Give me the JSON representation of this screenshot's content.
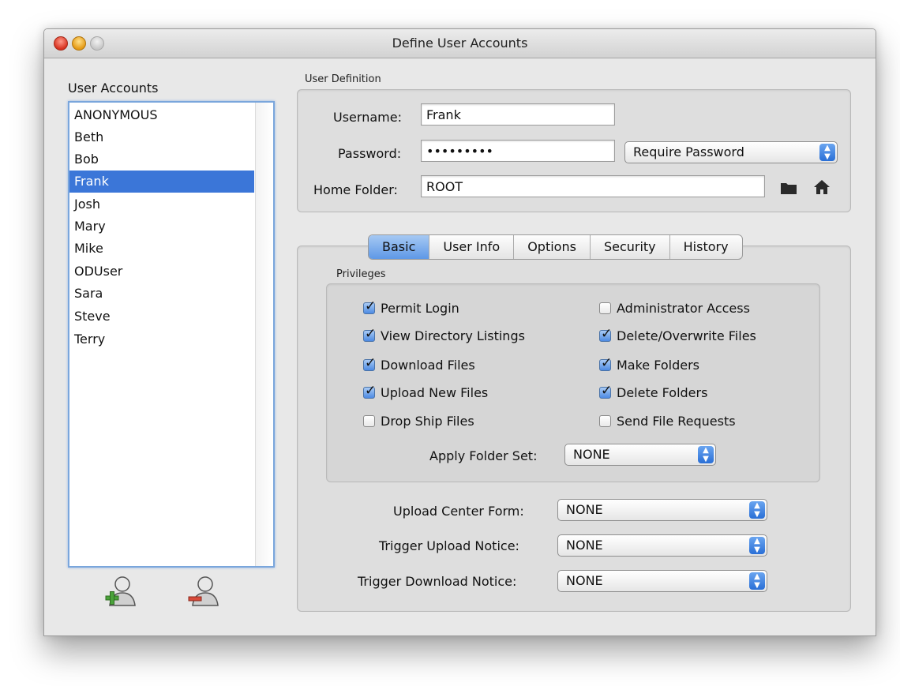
{
  "window": {
    "title": "Define User Accounts"
  },
  "accounts": {
    "heading": "User Accounts",
    "items": [
      "ANONYMOUS",
      "Beth",
      "Bob",
      "Frank",
      "Josh",
      "Mary",
      "Mike",
      "ODUser",
      "Sara",
      "Steve",
      "Terry"
    ],
    "selected": "Frank"
  },
  "user_definition": {
    "heading": "User Definition",
    "username_label": "Username:",
    "username_value": "Frank",
    "password_label": "Password:",
    "password_value": "•••••••••",
    "password_mode": "Require Password",
    "home_label": "Home Folder:",
    "home_value": "ROOT"
  },
  "tabs": [
    "Basic",
    "User Info",
    "Options",
    "Security",
    "History"
  ],
  "active_tab": "Basic",
  "privileges": {
    "heading": "Privileges",
    "left": [
      {
        "label": "Permit Login",
        "checked": true
      },
      {
        "label": "View Directory Listings",
        "checked": true
      },
      {
        "label": "Download Files",
        "checked": true
      },
      {
        "label": "Upload New Files",
        "checked": true
      },
      {
        "label": "Drop Ship Files",
        "checked": false
      }
    ],
    "right": [
      {
        "label": "Administrator Access",
        "checked": false
      },
      {
        "label": "Delete/Overwrite Files",
        "checked": true
      },
      {
        "label": "Make Folders",
        "checked": true
      },
      {
        "label": "Delete Folders",
        "checked": true
      },
      {
        "label": "Send File Requests",
        "checked": false
      }
    ],
    "folder_set_label": "Apply Folder Set:",
    "folder_set_value": "NONE"
  },
  "forms": {
    "upload_center_label": "Upload Center Form:",
    "upload_center_value": "NONE",
    "trigger_upload_label": "Trigger Upload Notice:",
    "trigger_upload_value": "NONE",
    "trigger_download_label": "Trigger Download Notice:",
    "trigger_download_value": "NONE"
  },
  "colors": {
    "selection": "#3b76d8",
    "accent": "#5e98e6"
  }
}
